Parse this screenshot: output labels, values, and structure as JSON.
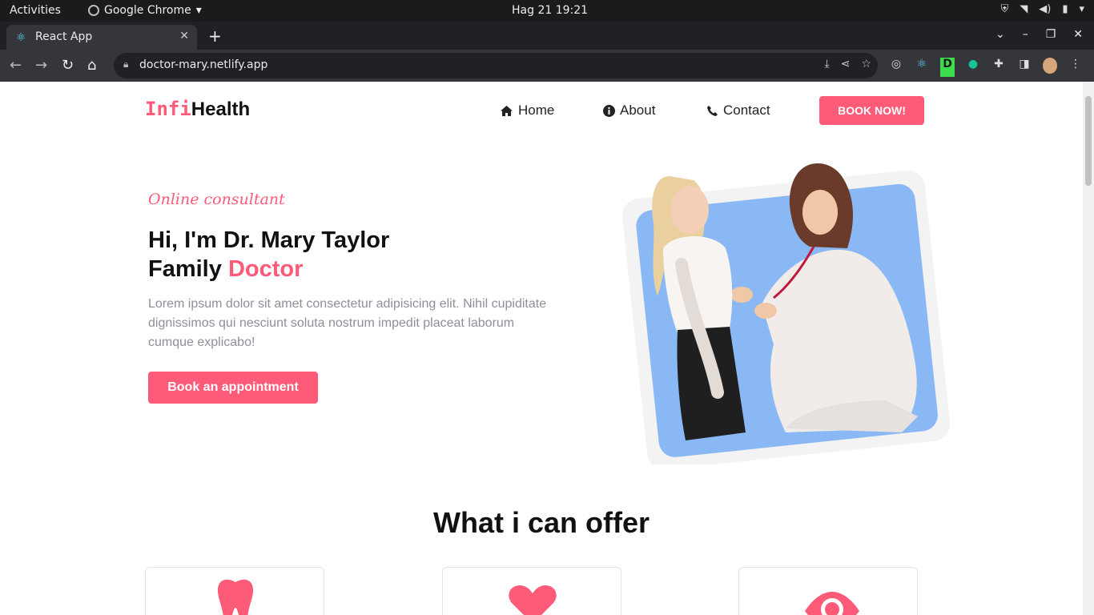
{
  "system": {
    "activities": "Activities",
    "app_name": "Google Chrome",
    "clock": "Hag 21  19:21"
  },
  "browser": {
    "tab_title": "React App",
    "url": "doctor-mary.netlify.app",
    "icons": [
      "back-icon",
      "forward-icon",
      "reload-icon",
      "home-icon",
      "install-icon",
      "share-icon",
      "star-icon",
      "extensions-icon",
      "sidepanel-icon",
      "menu-icon"
    ]
  },
  "site": {
    "logo_part1": "Infi",
    "logo_part2": "Health",
    "nav": {
      "home": "Home",
      "about": "About",
      "contact": "Contact",
      "book": "BOOK NOW!"
    },
    "hero": {
      "tagline": "Online consultant",
      "line1": "Hi, I'm Dr. Mary Taylor",
      "line2_prefix": "Family ",
      "line2_accent": "Doctor",
      "lead": "Lorem ipsum dolor sit amet consectetur adipisicing elit. Nihil cupiditate dignissimos qui nesciunt soluta nostrum impedit placeat laborum cumque explicabo!",
      "cta": "Book an appointment"
    },
    "offer": {
      "title": "What i can offer",
      "cards": [
        "tooth-icon",
        "heart-icon",
        "eye-icon"
      ]
    }
  },
  "colors": {
    "accent": "#fd5b78",
    "image_bg": "#89b8f5"
  }
}
